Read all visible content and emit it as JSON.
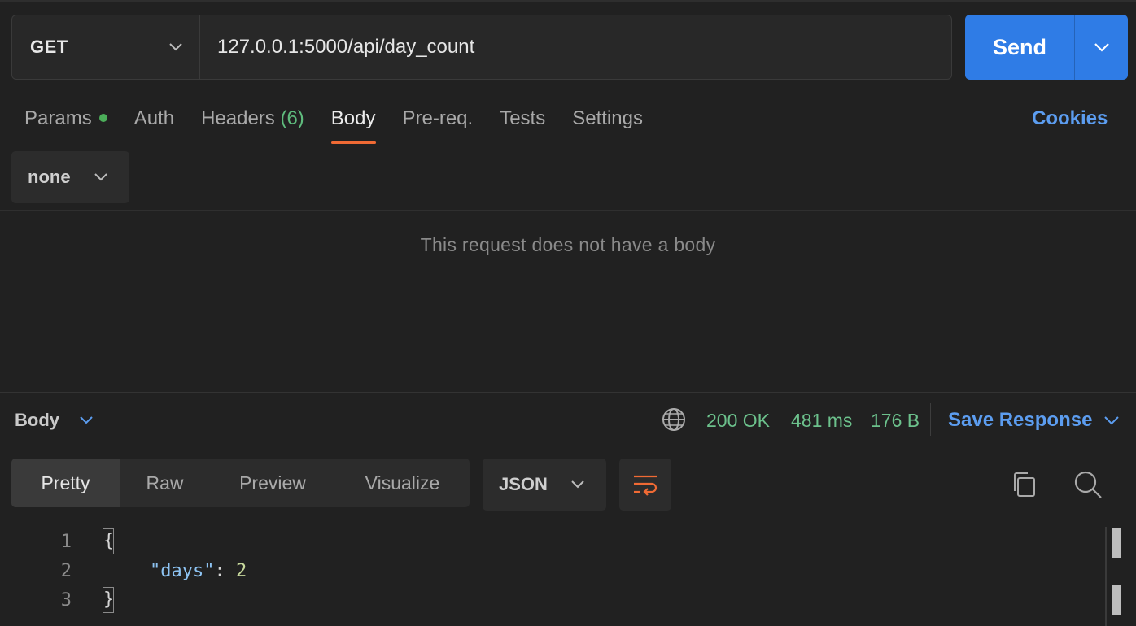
{
  "request": {
    "method": "GET",
    "url": "127.0.0.1:5000/api/day_count",
    "send_label": "Send"
  },
  "tabs": [
    {
      "label": "Params",
      "indicator": "dot"
    },
    {
      "label": "Auth"
    },
    {
      "label": "Headers",
      "count": "(6)"
    },
    {
      "label": "Body",
      "active": true
    },
    {
      "label": "Pre-req."
    },
    {
      "label": "Tests"
    },
    {
      "label": "Settings"
    }
  ],
  "cookies_label": "Cookies",
  "body_type": "none",
  "no_body_message": "This request does not have a body",
  "response": {
    "section_label": "Body",
    "status": "200 OK",
    "time": "481 ms",
    "size": "176 B",
    "save_label": "Save Response",
    "view_tabs": [
      "Pretty",
      "Raw",
      "Preview",
      "Visualize"
    ],
    "active_view": "Pretty",
    "format": "JSON",
    "code": {
      "line_numbers": [
        "1",
        "2",
        "3"
      ],
      "open_brace": "{",
      "key": "\"days\"",
      "colon": ": ",
      "value": "2",
      "close_brace": "}"
    }
  },
  "colors": {
    "accent_blue": "#2f7ce6",
    "link_blue": "#5c9df0",
    "active_tab_underline": "#f06a34",
    "status_green": "#6cc18c"
  },
  "icons": [
    "chevron-down-icon",
    "globe-icon",
    "wrap-lines-icon",
    "copy-icon",
    "search-icon"
  ]
}
